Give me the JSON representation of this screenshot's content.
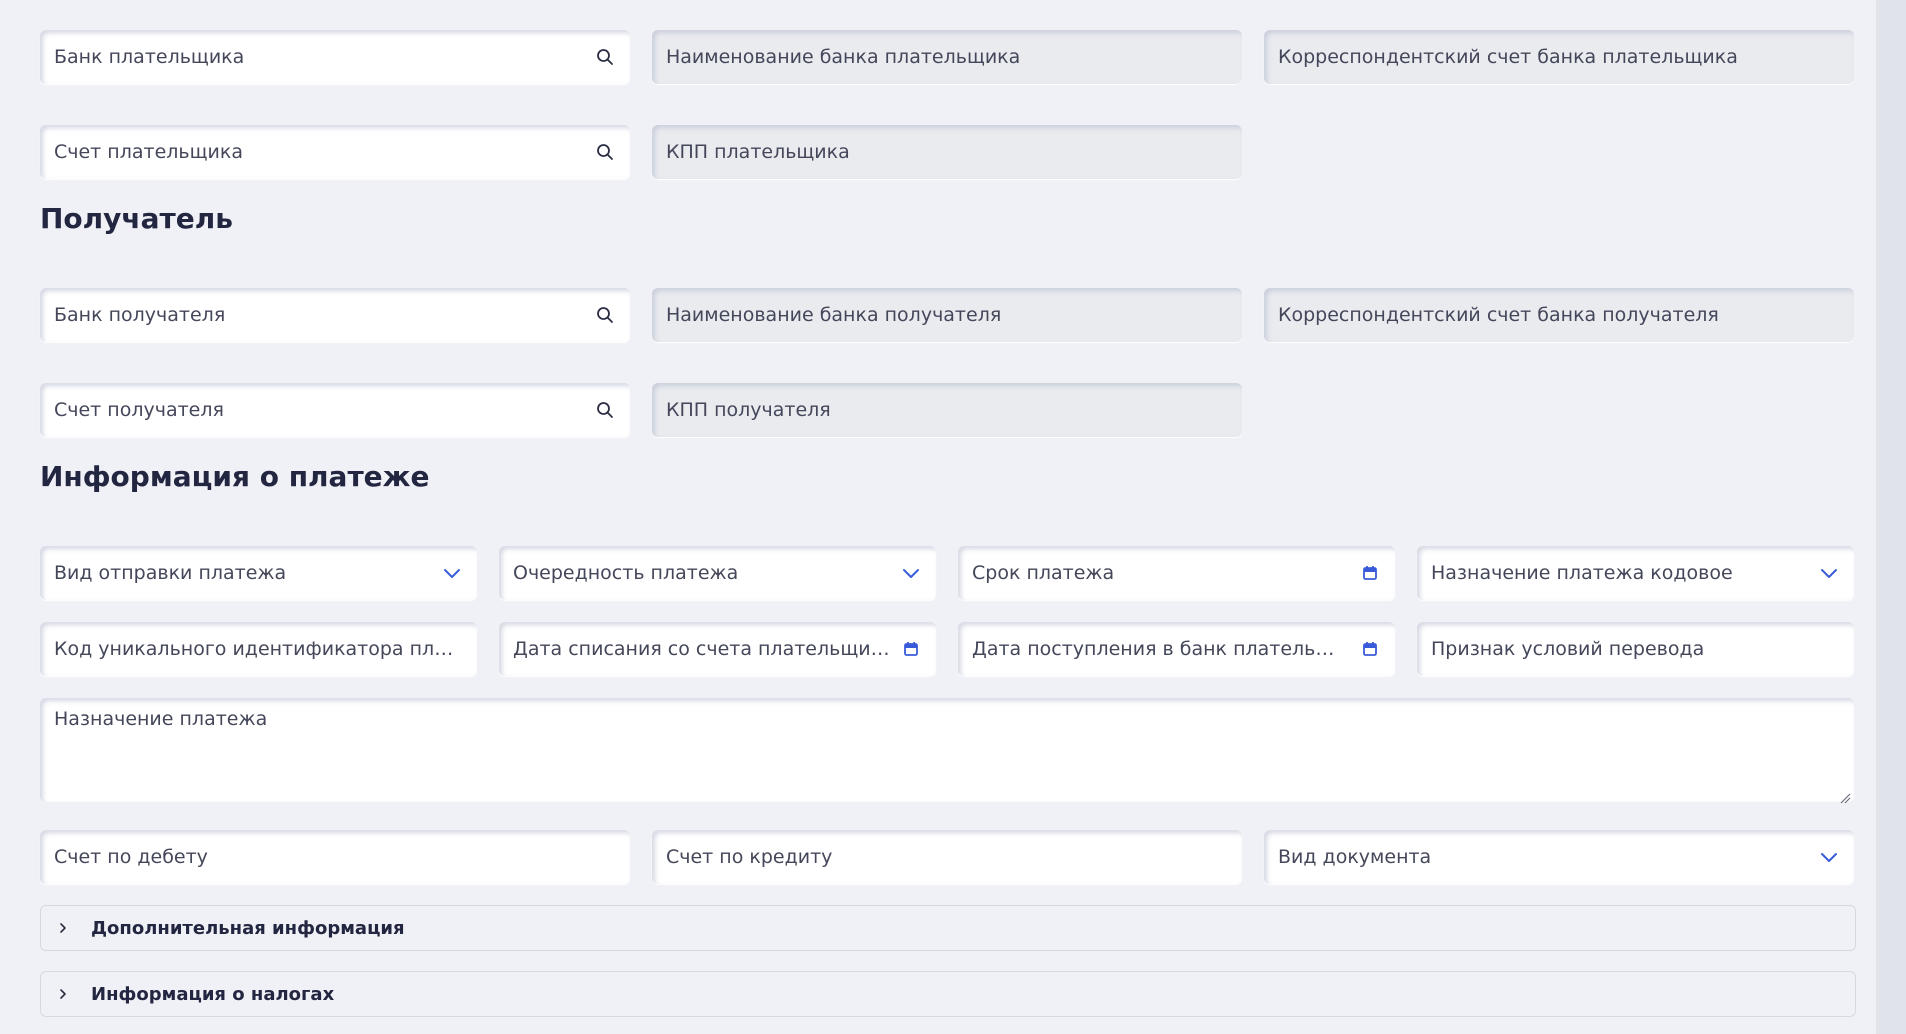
{
  "payer": {
    "bank": "Банк плательщика",
    "bank_name": "Наименование банка плательщика",
    "corr_account": "Корреспондентский счет банка плательщика",
    "account": "Счет плательщика",
    "kpp": "КПП плательщика"
  },
  "recipient": {
    "title": "Получатель",
    "bank": "Банк получателя",
    "bank_name": "Наименование банка получателя",
    "corr_account": "Корреспондентский счет банка получателя",
    "account": "Счет получателя",
    "kpp": "КПП получателя"
  },
  "payment_info": {
    "title": "Информация о платеже",
    "send_type": "Вид отправки платежа",
    "priority": "Очередность платежа",
    "due_date": "Срок платежа",
    "purpose_code": "Назначение платежа кодовое",
    "uid_code": "Код уникального идентификатора пла...",
    "debit_date": "Дата списания со счета плательщика",
    "receipt_date": "Дата поступления в банк плательщика",
    "transfer_terms": "Признак условий перевода",
    "purpose": "Назначение платежа",
    "debit_account": "Счет по дебету",
    "credit_account": "Счет по кредиту",
    "document_type": "Вид документа"
  },
  "accordions": {
    "additional": "Дополнительная информация",
    "taxes": "Информация о налогах"
  },
  "colors": {
    "accent": "#3a5bd9",
    "background": "#f0f1f6",
    "readonly_field": "#e9ebef",
    "heading": "#232640"
  },
  "icons": {
    "search": "search-icon",
    "dropdown": "chevron-down-icon",
    "calendar": "calendar-icon",
    "expand": "chevron-right-icon"
  }
}
